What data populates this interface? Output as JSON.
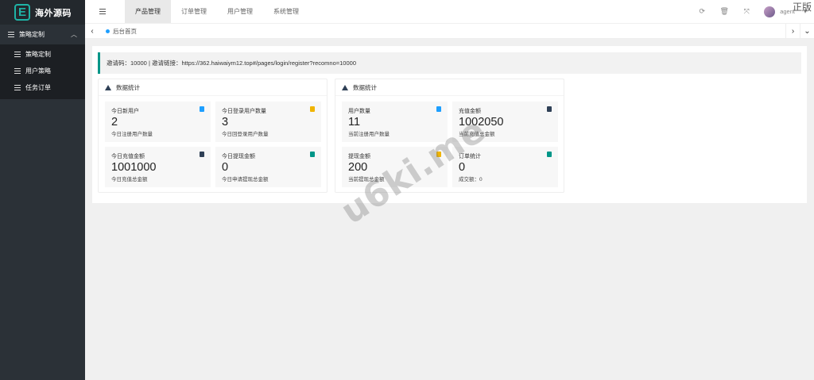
{
  "sidebar": {
    "logo_letter": "E",
    "logo_text": "海外源码",
    "group_label": "策略定制",
    "items": [
      {
        "label": "策略定制"
      },
      {
        "label": "用户策略"
      },
      {
        "label": "任务订单"
      }
    ]
  },
  "topbar": {
    "tabs": [
      {
        "label": "产品管理",
        "active": true
      },
      {
        "label": "订单管理"
      },
      {
        "label": "用户管理"
      },
      {
        "label": "系统管理"
      }
    ],
    "user_name": "agent",
    "corner_label": "正版"
  },
  "tabsbar": {
    "home_label": "后台首页"
  },
  "invite": {
    "text": "邀请码：10000 | 邀请链接：https://362.haiwaiym12.top#/pages/login/register?recomno=10000"
  },
  "panels": [
    {
      "title": "数据统计",
      "stats": [
        {
          "label": "今日新用户",
          "value": "2",
          "desc": "今日注册用户数量",
          "badge_color": "#1e9fff"
        },
        {
          "label": "今日登录用户数量",
          "value": "3",
          "desc": "今日回登录用户数量",
          "badge_color": "#f0b400"
        },
        {
          "label": "今日充值金额",
          "value": "1001000",
          "desc": "今日充值总金额",
          "badge_color": "#2f4056"
        },
        {
          "label": "今日提现金额",
          "value": "0",
          "desc": "今日申请提现总金额",
          "badge_color": "#009688"
        }
      ]
    },
    {
      "title": "数据统计",
      "stats": [
        {
          "label": "用户数量",
          "value": "11",
          "desc": "当前注册用户数量",
          "badge_color": "#1e9fff"
        },
        {
          "label": "充值金额",
          "value": "1002050",
          "desc": "当前充值总金额",
          "badge_color": "#2f4056"
        },
        {
          "label": "提现金额",
          "value": "200",
          "desc": "当前提现总金额",
          "badge_color": "#f0b400"
        },
        {
          "label": "订单统计",
          "value": "0",
          "desc": "成交额：0",
          "badge_color": "#009688"
        }
      ]
    }
  ],
  "watermark": "u6ki.me",
  "colors": {
    "sidebar_bg": "#2b3137",
    "accent": "#009688",
    "active_dot": "#1e9fff"
  }
}
